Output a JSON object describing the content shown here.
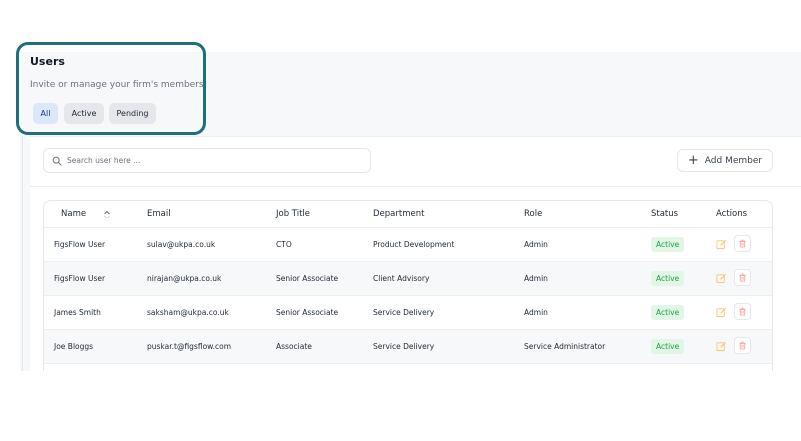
{
  "header": {
    "title": "Users",
    "subtitle": "Invite or manage your firm's members",
    "filters": [
      "All",
      "Active",
      "Pending"
    ]
  },
  "toolbar": {
    "search_placeholder": "Search user here ...",
    "add_label": "Add Member"
  },
  "table": {
    "columns": [
      "Name",
      "Email",
      "Job Title",
      "Department",
      "Role",
      "Status",
      "Actions"
    ],
    "rows": [
      [
        "FigsFlow User",
        "sulav@ukpa.co.uk",
        "CTO",
        "Product Development",
        "Admin",
        "Active"
      ],
      [
        "FigsFlow User",
        "nirajan@ukpa.co.uk",
        "Senior Associate",
        "Client Advisory",
        "Admin",
        "Active"
      ],
      [
        "James Smith",
        "saksham@ukpa.co.uk",
        "Senior Associate",
        "Service Delivery",
        "Admin",
        "Active"
      ],
      [
        "Joe Bloggs",
        "puskar.t@figsflow.com",
        "Associate",
        "Service Delivery",
        "Service Administrator",
        "Active"
      ]
    ]
  },
  "colors": {
    "highlight": "#1e6f78",
    "active_badge_bg": "#e3f6e6",
    "active_badge_text": "#16a34a",
    "edit_icon": "#f6c66b",
    "delete_icon": "#f3a5a5"
  },
  "icons": {
    "search": "search-icon",
    "add": "plus-icon",
    "sort": "sort-icon",
    "edit": "edit-icon",
    "delete": "trash-icon"
  }
}
